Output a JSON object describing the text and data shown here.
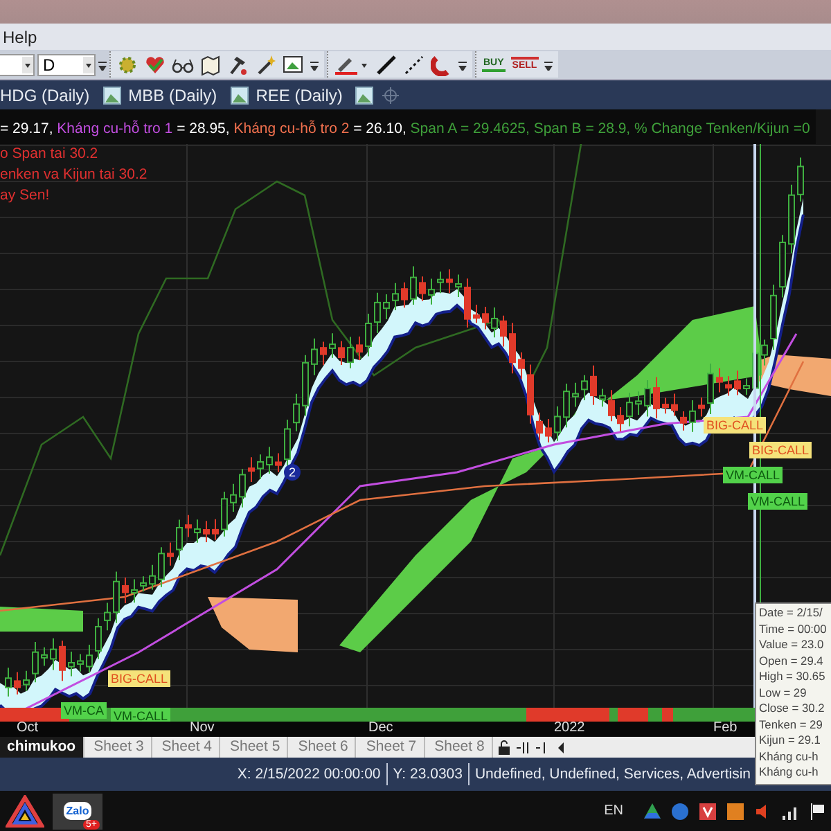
{
  "menu_bar": [
    "Help"
  ],
  "toolbar": {
    "interval_value": "D",
    "buy_label": "BUY",
    "sell_label": "SELL"
  },
  "chart_tabs": [
    {
      "label": "HDG (Daily)"
    },
    {
      "label": "MBB (Daily)"
    },
    {
      "label": "REE (Daily)"
    }
  ],
  "chart": {
    "title_segments": [
      {
        "text": "= 29.17, ",
        "color": "#ffffff"
      },
      {
        "text": "Kháng cu-hỗ tro 1",
        "color": "#c24ee0"
      },
      {
        "text": " = 28.95, ",
        "color": "#ffffff"
      },
      {
        "text": "Kháng cu-hỗ tro 2",
        "color": "#f0704e"
      },
      {
        "text": " = 26.10, ",
        "color": "#ffffff"
      },
      {
        "text": "Span A = 29.4625, Span B = 28.9, % Change Tenken/Kijun =0",
        "color": "#3fa03a"
      }
    ],
    "notes": [
      "o Span tai 30.2",
      "enken va Kijun tai 30.2",
      "ay Sen!"
    ],
    "marker": "2",
    "signals": [
      {
        "kind": "big-call",
        "text": "BIG-CALL"
      },
      {
        "kind": "vm-call",
        "text": "VM-CA"
      },
      {
        "kind": "vm-call",
        "text": "VM-CALL"
      },
      {
        "kind": "big-call",
        "text": "BIG-CALL"
      },
      {
        "kind": "vm-call",
        "text": "VM-CALL"
      },
      {
        "kind": "big-call",
        "text": "BIG-CALL"
      },
      {
        "kind": "vm-call",
        "text": "VM-CALL"
      }
    ],
    "x_labels": [
      "Oct",
      "Nov",
      "Dec",
      "2022",
      "Feb"
    ]
  },
  "sheet_tabs": [
    {
      "label": "chimukoo",
      "selected": true
    },
    {
      "label": "Sheet 3",
      "selected": false
    },
    {
      "label": "Sheet 4",
      "selected": false
    },
    {
      "label": "Sheet 5",
      "selected": false
    },
    {
      "label": "Sheet 6",
      "selected": false
    },
    {
      "label": "Sheet 7",
      "selected": false
    },
    {
      "label": "Sheet 8",
      "selected": false
    }
  ],
  "status_bar": {
    "x": "X: 2/15/2022 00:00:00",
    "y": "Y: 23.0303",
    "info": "Undefined, Undefined, Services, Advertisin"
  },
  "tooltip": {
    "lines": [
      "Date = 2/15/",
      "Time = 00:00",
      "Value = 23.0",
      "Open = 29.4",
      "High = 30.65",
      "Low = 29",
      "Close = 30.2",
      "Tenken = 29",
      "Kijun = 29.1",
      "Kháng cu-h",
      "Kháng cu-h"
    ]
  },
  "taskbar": {
    "zalo_label": "Zalo",
    "zalo_badge": "5+",
    "language": "EN"
  }
}
